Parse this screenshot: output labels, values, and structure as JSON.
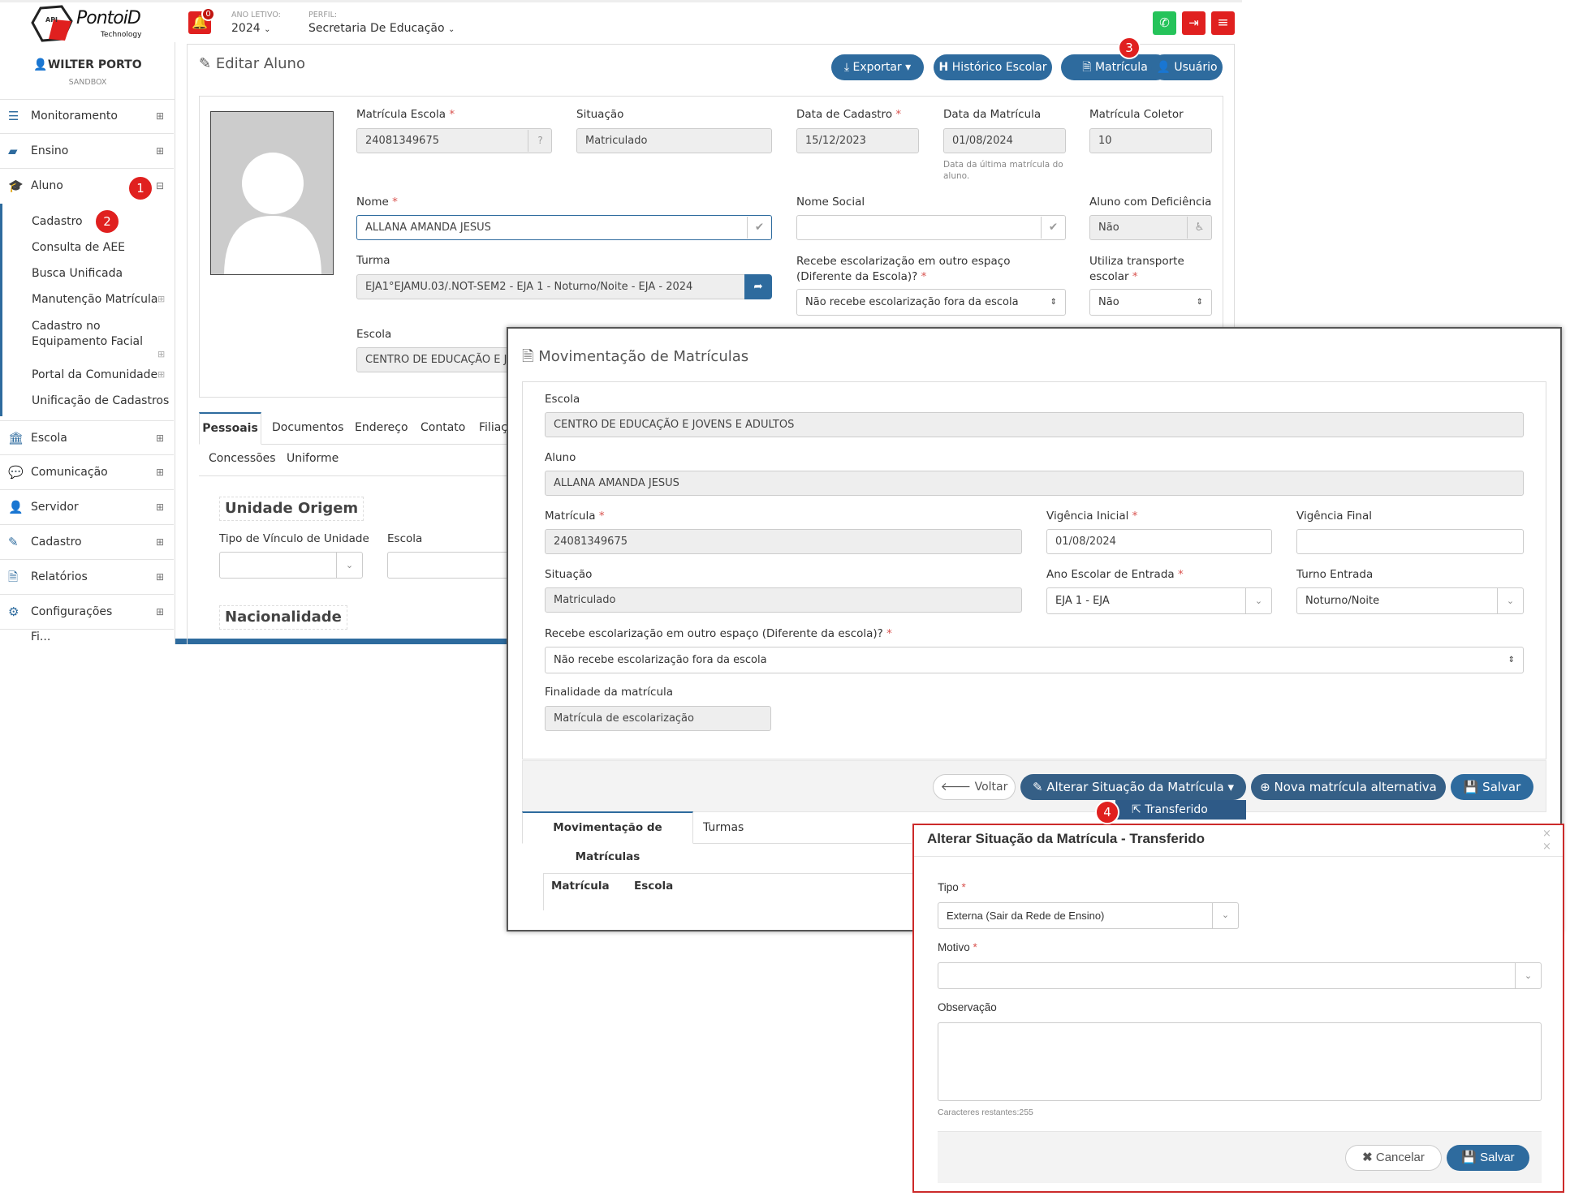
{
  "header": {
    "logo_text": "PontoiD",
    "logo_sub": "Technology",
    "logo_api": "API",
    "notif_count": "0",
    "ano_letivo_label": "ANO LETIVO:",
    "ano_letivo_value": "2024",
    "perfil_label": "PERFIL:",
    "perfil_value": "Secretaria De Educação"
  },
  "user": {
    "name": "WILTER PORTO",
    "env": "SANDBOX"
  },
  "sidebar": {
    "items": [
      {
        "label": "Monitoramento"
      },
      {
        "label": "Ensino"
      },
      {
        "label": "Aluno"
      },
      {
        "label": "Escola"
      },
      {
        "label": "Comunicação"
      },
      {
        "label": "Servidor"
      },
      {
        "label": "Cadastro"
      },
      {
        "label": "Relatórios"
      },
      {
        "label": "Configurações"
      },
      {
        "label": "Fi..."
      }
    ],
    "aluno_sub": [
      "Cadastro",
      "Consulta de AEE",
      "Busca Unificada",
      "Manutenção Matrícula",
      "Cadastro no Equipamento Facial",
      "Portal da Comunidade",
      "Unificação de Cadastros"
    ]
  },
  "badges": {
    "b1": "1",
    "b2": "2",
    "b3": "3",
    "b4": "4"
  },
  "page": {
    "title": "Editar Aluno",
    "btn_exportar": "Exportar",
    "btn_historico": "Histórico Escolar",
    "btn_matricula": "Matrícula",
    "btn_usuario": "Usuário"
  },
  "form": {
    "matricula_escola_label": "Matrícula Escola",
    "matricula_escola": "24081349675",
    "situacao_label": "Situação",
    "situacao": "Matriculado",
    "data_cadastro_label": "Data de Cadastro",
    "data_cadastro": "15/12/2023",
    "data_matricula_label": "Data da Matrícula",
    "data_matricula": "01/08/2024",
    "data_matricula_hint": "Data da última matrícula do aluno.",
    "matricula_coletor_label": "Matrícula Coletor",
    "matricula_coletor": "10",
    "nome_label": "Nome",
    "nome": "ALLANA AMANDA JESUS",
    "nome_social_label": "Nome Social",
    "nome_social": "",
    "deficiencia_label": "Aluno com Deficiência",
    "deficiencia": "Não",
    "turma_label": "Turma",
    "turma": "EJA1°EJAMU.03/.NOT-SEM2 - EJA 1 - Noturno/Noite - EJA - 2024",
    "recebe_label": "Recebe escolarização em outro espaço (Diferente da Escola)?",
    "recebe": "Não recebe escolarização fora da escola",
    "transporte_label": "Utiliza transporte escolar",
    "transporte": "Não",
    "escola_label": "Escola",
    "escola": "CENTRO DE EDUCAÇÃO E JOV"
  },
  "tabs": [
    "Pessoais",
    "Documentos",
    "Endereço",
    "Contato",
    "Filiaç",
    "Concessões",
    "Uniforme"
  ],
  "section": {
    "unidade_origem": "Unidade Origem",
    "tipo_vinculo_label": "Tipo de Vínculo de Unidade",
    "escola_label": "Escola",
    "nacionalidade": "Nacionalidade"
  },
  "mov": {
    "title": "Movimentação de Matrículas",
    "escola_label": "Escola",
    "escola": "CENTRO DE EDUCAÇÃO E JOVENS E ADULTOS",
    "aluno_label": "Aluno",
    "aluno": "ALLANA AMANDA JESUS",
    "matricula_label": "Matrícula",
    "matricula": "24081349675",
    "vig_ini_label": "Vigência Inicial",
    "vig_ini": "01/08/2024",
    "vig_fim_label": "Vigência Final",
    "vig_fim": "",
    "situacao_label": "Situação",
    "situacao": "Matriculado",
    "ano_label": "Ano Escolar de Entrada",
    "ano": "EJA 1 - EJA",
    "turno_label": "Turno Entrada",
    "turno": "Noturno/Noite",
    "recebe_label": "Recebe escolarização em outro espaço (Diferente da escola)?",
    "recebe": "Não recebe escolarização fora da escola",
    "finalidade_label": "Finalidade da matrícula",
    "finalidade": "Matrícula de escolarização",
    "btn_voltar": "Voltar",
    "btn_alterar": "Alterar Situação da Matrícula",
    "btn_nova": "Nova matrícula alternativa",
    "btn_salvar": "Salvar",
    "dropdown_item": "Transferido",
    "tab1": "Movimentação de Matrículas",
    "tab2": "Turmas",
    "col1": "Matrícula",
    "col2": "Escola"
  },
  "modal": {
    "title": "Alterar Situação da Matrícula - Transferido",
    "tipo_label": "Tipo",
    "tipo": "Externa (Sair da Rede de Ensino)",
    "motivo_label": "Motivo",
    "motivo": "",
    "obs_label": "Observação",
    "chars": "Caracteres restantes:255",
    "btn_cancelar": "Cancelar",
    "btn_salvar": "Salvar"
  }
}
